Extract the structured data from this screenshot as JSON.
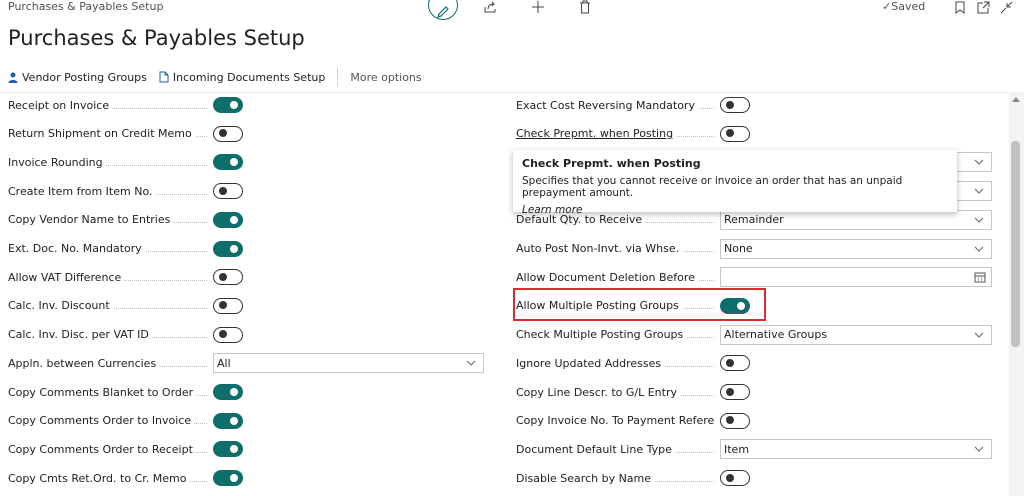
{
  "header": {
    "breadcrumb": "Purchases & Payables Setup",
    "title": "Purchases & Payables Setup",
    "saved": "Saved"
  },
  "actions": [
    {
      "label": "Vendor Posting Groups",
      "icon": "person-icon"
    },
    {
      "label": "Incoming Documents Setup",
      "icon": "document-icon"
    },
    {
      "label": "More options",
      "icon": ""
    }
  ],
  "left_fields": [
    {
      "label": "Receipt on Invoice",
      "type": "toggle",
      "on": true
    },
    {
      "label": "Return Shipment on Credit Memo",
      "type": "toggle",
      "on": false
    },
    {
      "label": "Invoice Rounding",
      "type": "toggle",
      "on": true
    },
    {
      "label": "Create Item from Item No.",
      "type": "toggle",
      "on": false
    },
    {
      "label": "Copy Vendor Name to Entries",
      "type": "toggle",
      "on": true
    },
    {
      "label": "Ext. Doc. No. Mandatory",
      "type": "toggle",
      "on": true
    },
    {
      "label": "Allow VAT Difference",
      "type": "toggle",
      "on": false
    },
    {
      "label": "Calc. Inv. Discount",
      "type": "toggle",
      "on": false
    },
    {
      "label": "Calc. Inv. Disc. per VAT ID",
      "type": "toggle",
      "on": false
    },
    {
      "label": "Appln. between Currencies",
      "type": "select",
      "value": "All"
    },
    {
      "label": "Copy Comments Blanket to Order",
      "type": "toggle",
      "on": true
    },
    {
      "label": "Copy Comments Order to Invoice",
      "type": "toggle",
      "on": true
    },
    {
      "label": "Copy Comments Order to Receipt",
      "type": "toggle",
      "on": true
    },
    {
      "label": "Copy Cmts Ret.Ord. to Cr. Memo",
      "type": "toggle",
      "on": true
    }
  ],
  "right_fields": [
    {
      "label": "Exact Cost Reversing Mandatory",
      "type": "toggle",
      "on": false
    },
    {
      "label": "Check Prepmt. when Posting",
      "type": "toggle",
      "on": false
    },
    {
      "label": "",
      "type": "select",
      "value": ""
    },
    {
      "label": "",
      "type": "select",
      "value": ""
    },
    {
      "label": "Default Qty. to Receive",
      "type": "select",
      "value": "Remainder"
    },
    {
      "label": "Auto Post Non-Invt. via Whse.",
      "type": "select",
      "value": "None"
    },
    {
      "label": "Allow Document Deletion Before",
      "type": "date",
      "value": ""
    },
    {
      "label": "Allow Multiple Posting Groups",
      "type": "toggle",
      "on": true
    },
    {
      "label": "Check Multiple Posting Groups",
      "type": "select",
      "value": "Alternative Groups"
    },
    {
      "label": "Ignore Updated Addresses",
      "type": "toggle",
      "on": false
    },
    {
      "label": "Copy Line Descr. to G/L Entry",
      "type": "toggle",
      "on": false
    },
    {
      "label": "Copy Invoice No. To Payment Reference",
      "type": "toggle",
      "on": false
    },
    {
      "label": "Document Default Line Type",
      "type": "select",
      "value": "Item"
    },
    {
      "label": "Disable Search by Name",
      "type": "toggle",
      "on": false
    }
  ],
  "tooltip": {
    "title": "Check Prepmt. when Posting",
    "body": "Specifies that you cannot receive or invoice an order that has an unpaid prepayment amount.",
    "link": "Learn more"
  },
  "colors": {
    "accent": "#0e6e6c",
    "highlight": "#d32f2f"
  }
}
